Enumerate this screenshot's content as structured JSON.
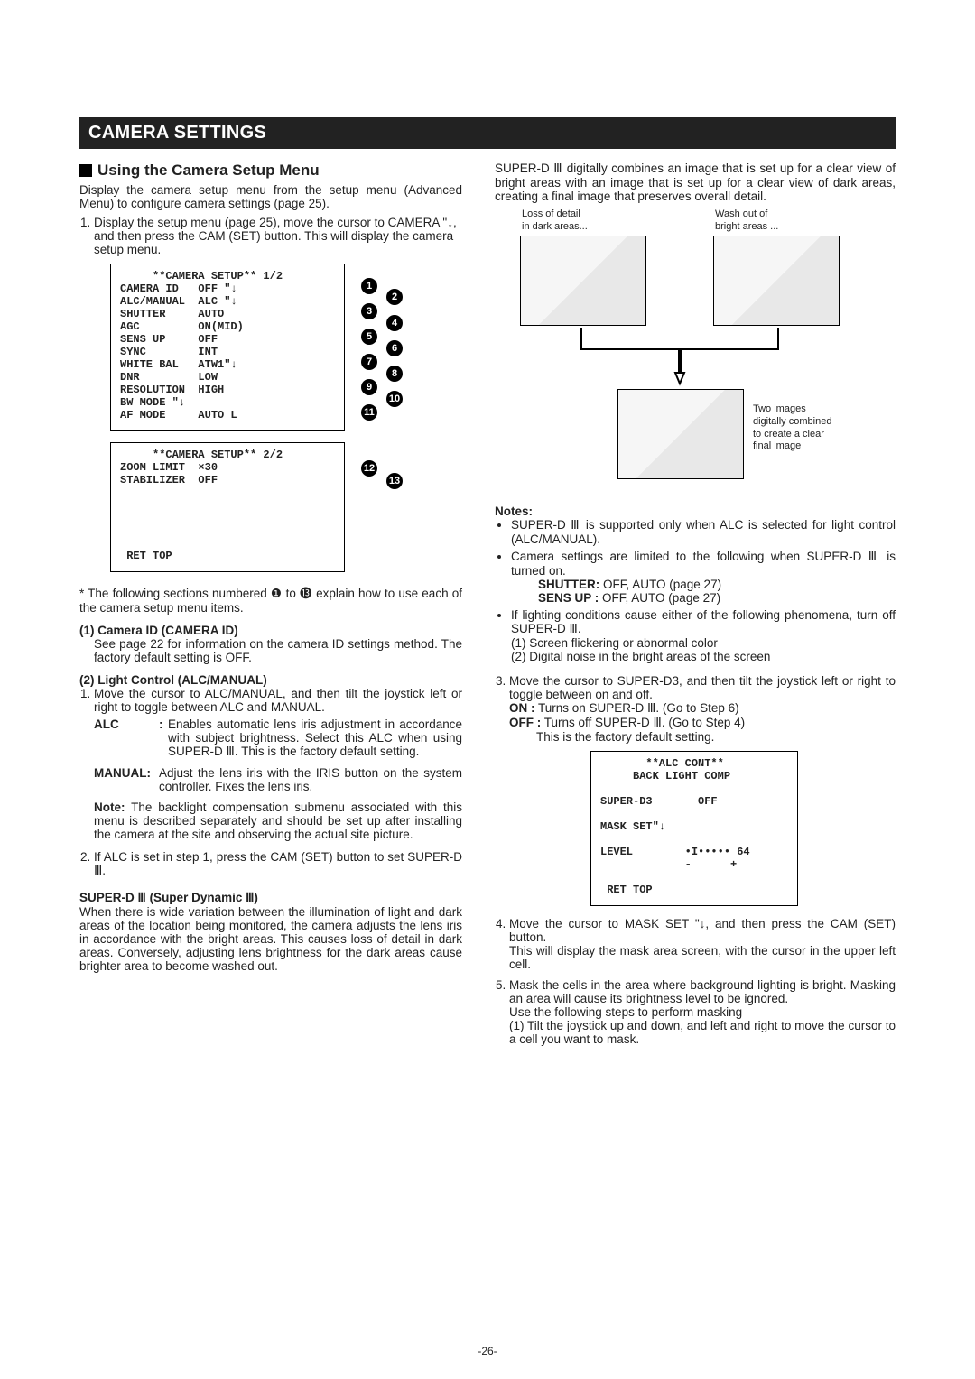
{
  "pageNumber": "-26-",
  "titleBar": "CAMERA SETTINGS",
  "left": {
    "sectionTitle": "Using the Camera Setup Menu",
    "intro": "Display the camera setup menu from the setup menu (Advanced Menu) to configure camera settings (page 25).",
    "step1": "Display the setup menu (page 25), move the cursor to CAMERA \"↓, and then press the CAM (SET) button. This will display the camera setup menu.",
    "menu1": "     **CAMERA SETUP** 1/2\nCAMERA ID   OFF \"↓\nALC/MANUAL  ALC \"↓\nSHUTTER     AUTO\nAGC         ON(MID)\nSENS UP     OFF\nSYNC        INT\nWHITE BAL   ATW1\"↓\nDNR         LOW\nRESOLUTION  HIGH\nBW MODE \"↓\nAF MODE     AUTO L",
    "menu2": "     **CAMERA SETUP** 2/2\nZOOM LIMIT  ×30\nSTABILIZER  OFF\n\n\n\n\n\n RET TOP",
    "footnote": "* The following sections numbered ❶ to ⓭ explain how to use each of the camera setup menu items.",
    "sub1h": "(1) Camera ID (CAMERA ID)",
    "sub1p": "See page 22 for information on the camera ID settings method. The factory default setting is OFF.",
    "sub2h": "(2) Light Control (ALC/MANUAL)",
    "sub2s1": "Move the cursor to ALC/MANUAL, and then tilt the joystick left or right to toggle between ALC and MANUAL.",
    "alcLabel": "ALC",
    "alcBody": "Enables automatic lens iris adjustment in accordance with subject brightness. Select this ALC when using SUPER-D Ⅲ. This is the factory default setting.",
    "manualLabel": "MANUAL:",
    "manualBody": "Adjust the lens iris with the IRIS button on the system controller. Fixes the lens iris.",
    "noteLead": "Note:",
    "noteBody": "The backlight compensation submenu associated with this menu is described separately and should be set up after installing the camera at the site and observing the actual site picture.",
    "sub2s2": "If ALC is set in step 1, press the CAM (SET) button to set SUPER-D Ⅲ.",
    "sdh": "SUPER-D Ⅲ (Super Dynamic Ⅲ)",
    "sdp": "When there is wide variation between the illumination of light and dark areas of the location being monitored, the camera adjusts the lens iris in accordance with the bright areas. This causes loss of detail in dark areas. Conversely, adjusting lens brightness for the dark areas cause brighter area to become washed out."
  },
  "right": {
    "topPara": "SUPER-D Ⅲ digitally combines an image that is set up for a clear view of bright areas with an image that is set up for a clear view of dark areas, creating a final image that preserves overall detail.",
    "dLabel1": "Loss of detail\nin dark areas...",
    "dLabel2": "Wash out of\nbright areas ...",
    "dLabel3": "Two images\ndigitally combined\nto create a clear\nfinal image",
    "notes": "Notes:",
    "n1": "SUPER-D Ⅲ is supported only when ALC is selected for light control (ALC/MANUAL).",
    "n2": "Camera settings are limited to the following when SUPER-D Ⅲ is turned on.",
    "n2a_label": "SHUTTER:",
    "n2a": "OFF, AUTO (page 27)",
    "n2b_label": "SENS UP :",
    "n2b": "OFF, AUTO (page 27)",
    "n3": "If lighting conditions cause either of the following phenomena, turn off SUPER-D Ⅲ.",
    "n3a": "(1) Screen flickering or abnormal color",
    "n3b": "(2) Digital noise in the bright areas of the screen",
    "s3": "Move the cursor to SUPER-D3, and then tilt the joystick left or right to toggle between on and off.",
    "onLabel": "ON  :",
    "onBody": "Turns on SUPER-D Ⅲ. (Go to Step 6)",
    "offLabel": "OFF :",
    "offBody": "Turns off SUPER-D Ⅲ. (Go to Step 4)",
    "offNote": "This is the factory default setting.",
    "menu3": "       **ALC CONT**\n     BACK LIGHT COMP\n\nSUPER-D3       OFF\n\nMASK SET\"↓\n\nLEVEL        •I••••• 64\n             -      +\n\n RET TOP",
    "s4": "Move the cursor to MASK SET \"↓, and then press the CAM (SET) button.",
    "s4b": "This will display the mask area screen, with the cursor in the upper left cell.",
    "s5": "Mask the cells in the area where background lighting is bright. Masking an area will cause its brightness level to be ignored.",
    "s5b": "Use the following steps to perform masking",
    "s5c": "(1) Tilt the joystick up and down, and left and right to move the cursor to a cell you want to mask."
  },
  "chart_data": {
    "type": "table",
    "title": "Camera Setup Menu items (callouts 1–13)",
    "rows": [
      {
        "num": 1,
        "item": "CAMERA ID",
        "value": "OFF"
      },
      {
        "num": 2,
        "item": "ALC/MANUAL",
        "value": "ALC"
      },
      {
        "num": 3,
        "item": "SHUTTER",
        "value": "AUTO"
      },
      {
        "num": 4,
        "item": "AGC",
        "value": "ON(MID)"
      },
      {
        "num": 5,
        "item": "SENS UP",
        "value": "OFF"
      },
      {
        "num": 6,
        "item": "SYNC",
        "value": "INT"
      },
      {
        "num": 7,
        "item": "WHITE BAL",
        "value": "ATW1"
      },
      {
        "num": 8,
        "item": "DNR",
        "value": "LOW"
      },
      {
        "num": 9,
        "item": "RESOLUTION",
        "value": "HIGH"
      },
      {
        "num": 10,
        "item": "BW MODE",
        "value": ""
      },
      {
        "num": 11,
        "item": "AF MODE",
        "value": "AUTO L"
      },
      {
        "num": 12,
        "item": "ZOOM LIMIT",
        "value": "×30"
      },
      {
        "num": 13,
        "item": "STABILIZER",
        "value": "OFF"
      }
    ],
    "alc_cont_menu": {
      "SUPER-D3": "OFF",
      "MASK SET": "(submenu)",
      "LEVEL": 64
    }
  }
}
